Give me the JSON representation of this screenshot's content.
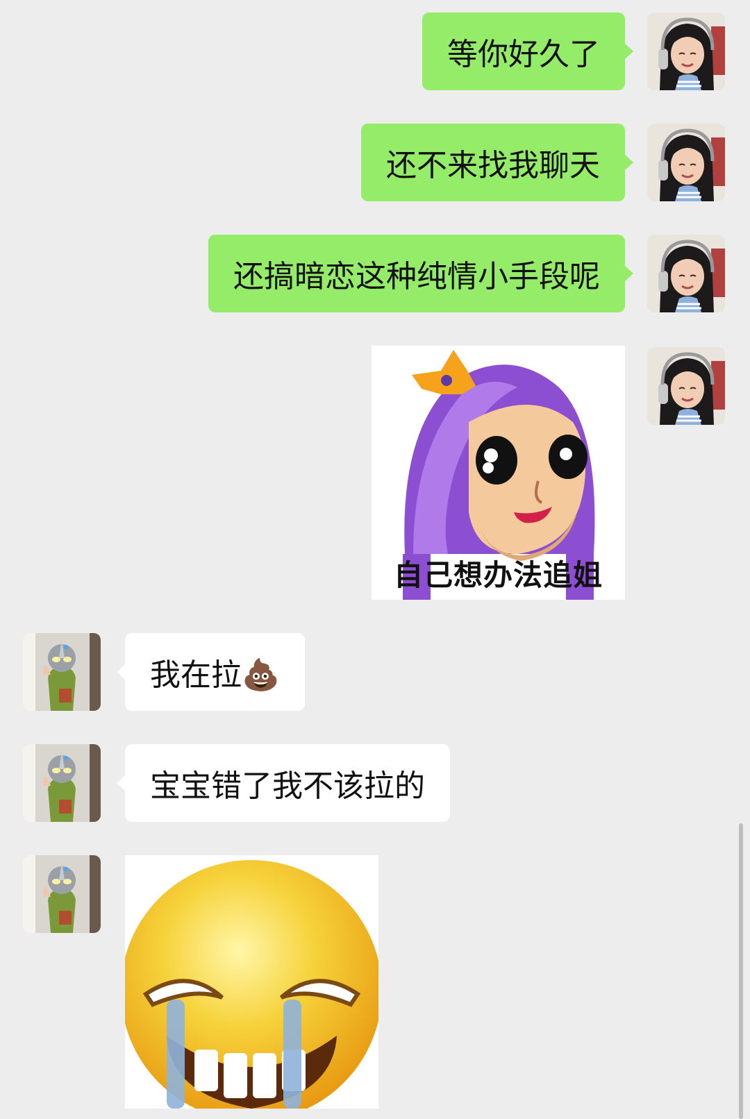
{
  "messages": {
    "m1": {
      "text": "等你好久了"
    },
    "m2": {
      "text": "还不来找我聊天"
    },
    "m3": {
      "text": "还搞暗恋这种纯情小手段呢"
    },
    "m4": {
      "sticker_caption": "自己想办法追姐",
      "sticker_name": "purple-hair-girl-sticker"
    },
    "m5": {
      "text": "我在拉💩"
    },
    "m6": {
      "text": "宝宝错了我不该拉的"
    },
    "m7": {
      "sticker_name": "crying-laughing-emoji-sticker"
    }
  },
  "colors": {
    "background": "#ededed",
    "outgoing_bubble": "#95ec69",
    "incoming_bubble": "#ffffff"
  }
}
